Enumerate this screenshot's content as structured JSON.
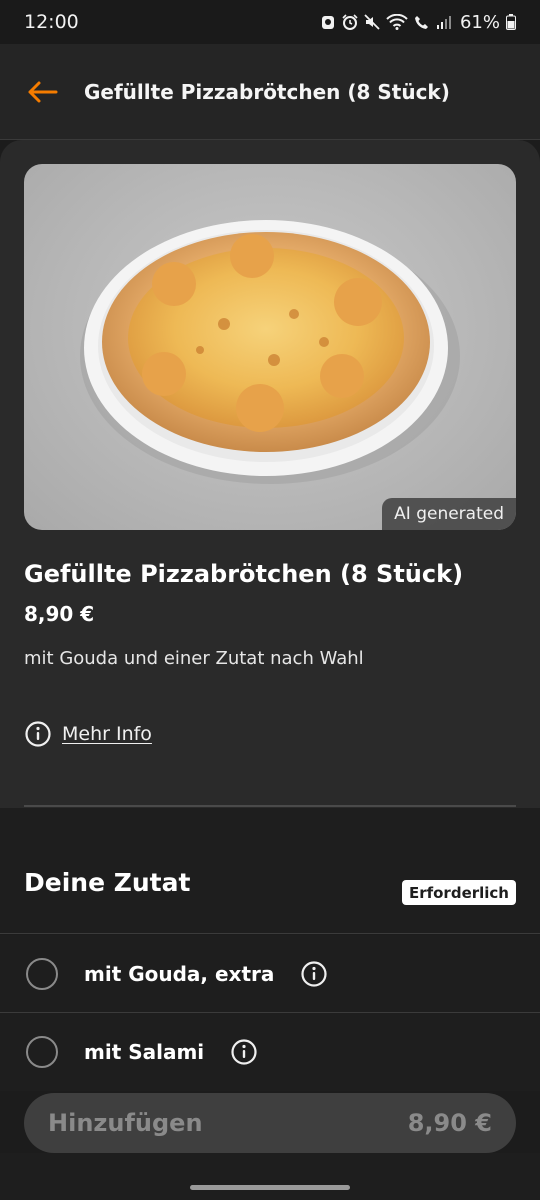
{
  "status_bar": {
    "time": "12:00",
    "battery": "61%",
    "icons": [
      "notification-icon",
      "alarm-icon",
      "mute-icon",
      "wifi-icon",
      "wifi-calling-icon",
      "signal-icon",
      "battery-icon"
    ]
  },
  "app_bar": {
    "back_icon": "arrow-left-icon",
    "title": "Gefüllte Pizzabrötchen (8 Stück)",
    "accent_color": "#f57c00"
  },
  "product": {
    "image_badge": "AI generated",
    "title": "Gefüllte Pizzabrötchen (8 Stück)",
    "price": "8,90 €",
    "description": "mit Gouda und einer Zutat nach Wahl",
    "more_info": "Mehr Info"
  },
  "options_section": {
    "title": "Deine Zutat",
    "required_badge": "Erforderlich",
    "options": [
      {
        "label": "mit Gouda, extra"
      },
      {
        "label": "mit Salami"
      }
    ]
  },
  "add_button": {
    "label": "Hinzufügen",
    "price": "8,90 €"
  }
}
